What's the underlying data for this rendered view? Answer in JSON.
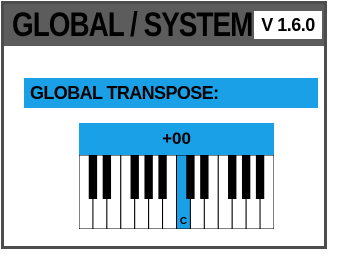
{
  "header": {
    "title": "GLOBAL / SYSTEM:",
    "version": "V 1.6.0"
  },
  "parameter": {
    "label": "GLOBAL TRANSPOSE:",
    "value": "+00"
  },
  "keyboard": {
    "white_key_count": 14,
    "black_key_after_white": [
      0,
      1,
      3,
      4,
      5,
      7,
      8,
      10,
      11,
      12
    ],
    "highlighted_white_key": 7,
    "highlighted_key_label": "C"
  },
  "colors": {
    "header_bg": "#5c5c5c",
    "accent": "#1aa0e6",
    "frame_border": "#4d4d4d"
  }
}
